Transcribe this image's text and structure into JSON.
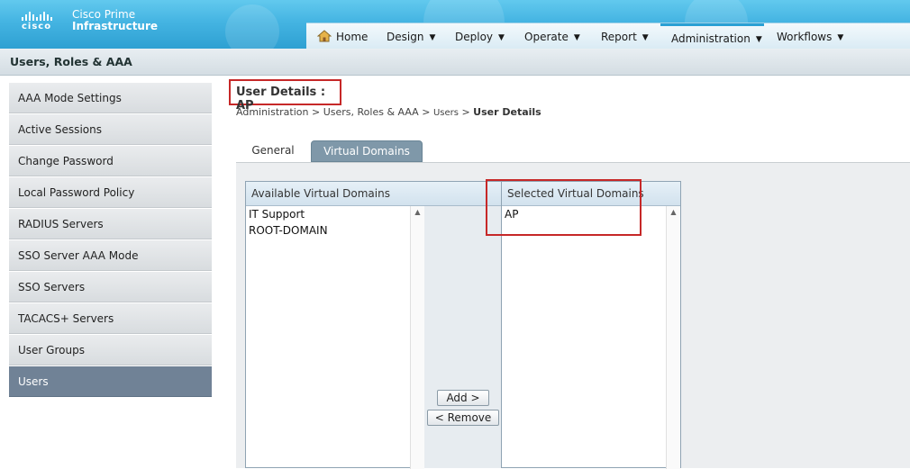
{
  "brand": {
    "company": "cisco",
    "product_line1": "Cisco Prime",
    "product_line2": "Infrastructure"
  },
  "nav": {
    "home": "Home",
    "items": [
      "Design",
      "Deploy",
      "Operate",
      "Report",
      "Administration",
      "Workflows"
    ],
    "active": "Administration"
  },
  "subheader": {
    "title": "Users, Roles & AAA"
  },
  "sidebar": {
    "items": [
      "AAA Mode Settings",
      "Active Sessions",
      "Change Password",
      "Local Password Policy",
      "RADIUS Servers",
      "SSO Server AAA Mode",
      "SSO Servers",
      "TACACS+ Servers",
      "User Groups",
      "Users"
    ],
    "active": "Users"
  },
  "page": {
    "title": "User Details : AP",
    "breadcrumb": {
      "part1": "Administration",
      "part2": "Users, Roles & AAA",
      "part3": "Users",
      "current": "User Details"
    }
  },
  "tabs": {
    "general": "General",
    "virtual_domains": "Virtual Domains",
    "active": "Virtual Domains"
  },
  "virtual_domains": {
    "available_header": "Available Virtual Domains",
    "available": [
      "IT Support",
      "ROOT-DOMAIN"
    ],
    "selected_header": "Selected Virtual Domains",
    "selected": [
      "AP"
    ],
    "add_label": "Add >",
    "remove_label": "< Remove"
  },
  "colors": {
    "header": "#44b4e2",
    "active_sidebar": "#708296",
    "highlight": "#c62828",
    "active_tab": "#7f98a9"
  }
}
